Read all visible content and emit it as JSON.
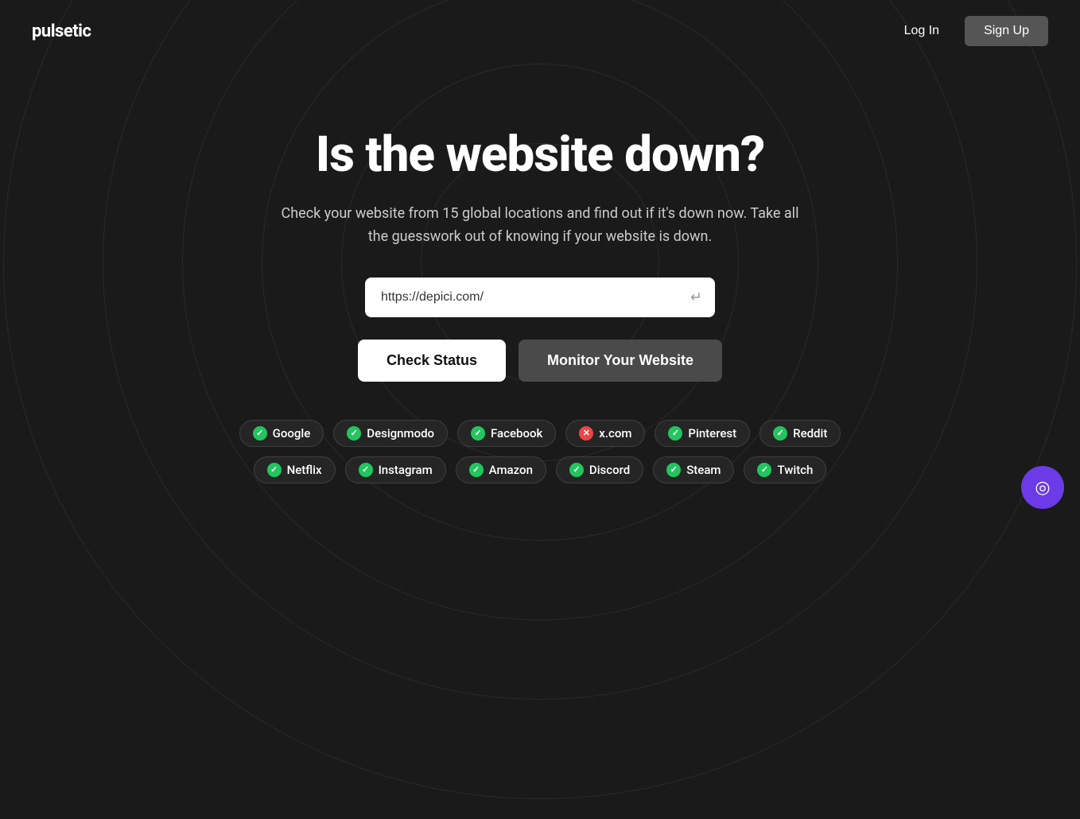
{
  "header": {
    "logo": "pulsetic",
    "nav": {
      "login_label": "Log In",
      "signup_label": "Sign Up"
    }
  },
  "hero": {
    "title": "Is the website down?",
    "subtitle": "Check your website from 15 global locations and find out if it's down now. Take all the guesswork out of knowing if your website is down.",
    "input_value": "https://depici.com/",
    "input_placeholder": "https://depici.com/"
  },
  "buttons": {
    "check_status": "Check Status",
    "monitor_website": "Monitor Your Website"
  },
  "tags_row1": [
    {
      "label": "Google",
      "status": "green"
    },
    {
      "label": "Designmodo",
      "status": "green"
    },
    {
      "label": "Facebook",
      "status": "green"
    },
    {
      "label": "x.com",
      "status": "red"
    },
    {
      "label": "Pinterest",
      "status": "green"
    },
    {
      "label": "Reddit",
      "status": "green"
    }
  ],
  "tags_row2": [
    {
      "label": "Netflix",
      "status": "green"
    },
    {
      "label": "Instagram",
      "status": "green"
    },
    {
      "label": "Amazon",
      "status": "green"
    },
    {
      "label": "Discord",
      "status": "green"
    },
    {
      "label": "Steam",
      "status": "green"
    },
    {
      "label": "Twitch",
      "status": "green"
    }
  ]
}
